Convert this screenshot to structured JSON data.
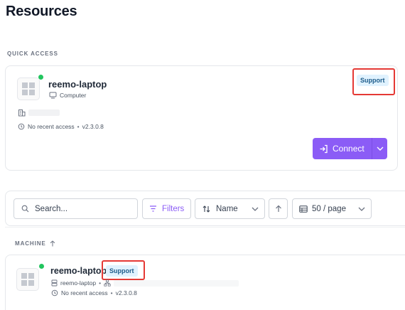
{
  "page": {
    "title": "Resources"
  },
  "quick_access": {
    "label": "QUICK ACCESS",
    "resource": {
      "name": "reemo-laptop",
      "type": "Computer",
      "badge": "Support",
      "last_access": "No recent access",
      "version": "v2.3.0.8",
      "status_color": "#22c55e"
    },
    "connect_label": "Connect"
  },
  "toolbar": {
    "search_placeholder": "Search...",
    "filters_label": "Filters",
    "sort_label": "Name",
    "page_size_label": "50 / page"
  },
  "list": {
    "column_header": "MACHINE",
    "rows": [
      {
        "name": "reemo-laptop",
        "badge": "Support",
        "host": "reemo-laptop",
        "last_access": "No recent access",
        "version": "v2.3.0.8"
      }
    ]
  },
  "colors": {
    "accent": "#8b5cf6",
    "highlight": "#e53935",
    "online": "#22c55e",
    "badge_bg": "#e0f2fe"
  }
}
